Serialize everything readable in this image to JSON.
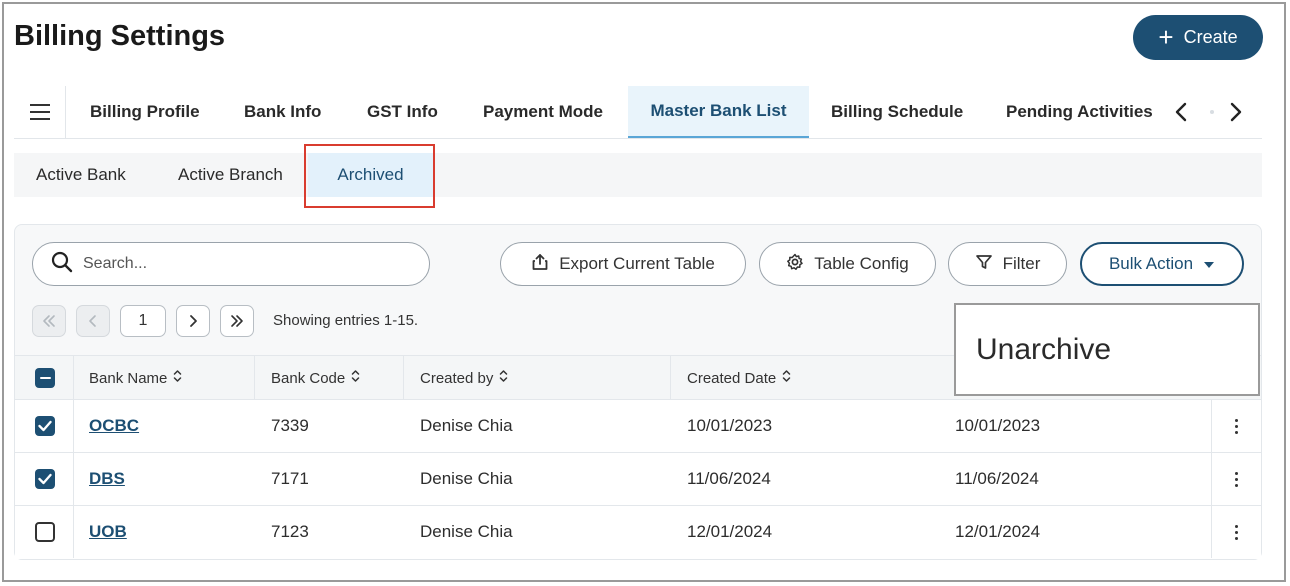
{
  "header": {
    "title": "Billing Settings",
    "create_label": "Create"
  },
  "tabs": [
    {
      "label": "Billing Profile",
      "active": false
    },
    {
      "label": "Bank Info",
      "active": false
    },
    {
      "label": "GST Info",
      "active": false
    },
    {
      "label": "Payment Mode",
      "active": false
    },
    {
      "label": "Master Bank List",
      "active": true
    },
    {
      "label": "Billing Schedule",
      "active": false
    },
    {
      "label": "Pending Activities",
      "active": false
    }
  ],
  "subtabs": [
    {
      "label": "Active Bank",
      "active": false
    },
    {
      "label": "Active Branch",
      "active": false
    },
    {
      "label": "Archived",
      "active": true
    }
  ],
  "toolbar": {
    "search_placeholder": "Search...",
    "export_label": "Export Current Table",
    "table_config_label": "Table Config",
    "filter_label": "Filter",
    "bulk_action_label": "Bulk Action"
  },
  "pagination": {
    "current_page": "1",
    "showing_text": "Showing entries 1-15."
  },
  "bulk_menu": {
    "items": [
      "Unarchive"
    ]
  },
  "table": {
    "columns": [
      "Bank Name",
      "Bank Code",
      "Created by",
      "Created Date"
    ],
    "rows": [
      {
        "bank_name": "OCBC",
        "bank_code": "7339",
        "created_by": "Denise Chia",
        "created_date": "10/01/2023",
        "modified_date": "10/01/2023",
        "checked": true
      },
      {
        "bank_name": "DBS",
        "bank_code": "7171",
        "created_by": "Denise Chia",
        "created_date": "11/06/2024",
        "modified_date": "11/06/2024",
        "checked": true
      },
      {
        "bank_name": "UOB",
        "bank_code": "7123",
        "created_by": "Denise Chia",
        "created_date": "12/01/2024",
        "modified_date": "12/01/2024",
        "checked": false
      }
    ]
  },
  "colors": {
    "primary": "#1d4f73",
    "accent": "#5aa6d6",
    "highlight": "#d93c2f"
  }
}
